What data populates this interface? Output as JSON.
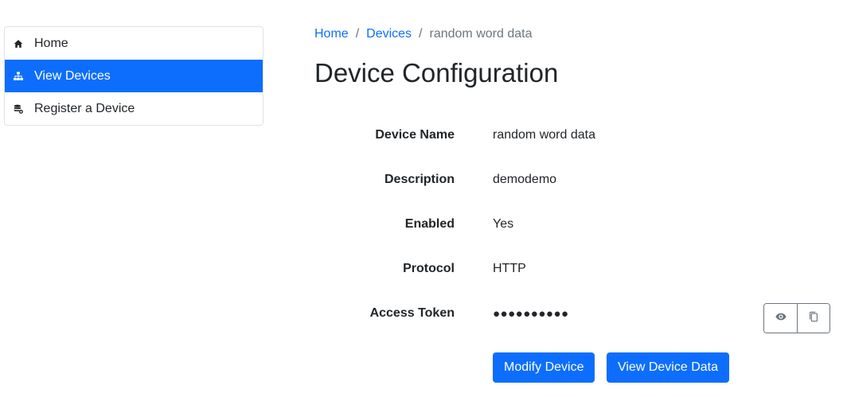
{
  "sidebar": {
    "items": [
      {
        "label": "Home",
        "icon": "home-icon",
        "active": false
      },
      {
        "label": "View Devices",
        "icon": "network-icon",
        "active": true
      },
      {
        "label": "Register a Device",
        "icon": "database-add-icon",
        "active": false
      }
    ]
  },
  "breadcrumb": {
    "home": "Home",
    "devices": "Devices",
    "current": "random word data",
    "separator": "/"
  },
  "page": {
    "title": "Device Configuration"
  },
  "details": {
    "device_name": {
      "label": "Device Name",
      "value": "random word data"
    },
    "description": {
      "label": "Description",
      "value": "demodemo"
    },
    "enabled": {
      "label": "Enabled",
      "value": "Yes"
    },
    "protocol": {
      "label": "Protocol",
      "value": "HTTP"
    },
    "access_token": {
      "label": "Access Token",
      "value": "●●●●●●●●●●"
    }
  },
  "token_actions": {
    "show_icon": "eye-icon",
    "copy_icon": "copy-icon"
  },
  "actions": {
    "modify": "Modify Device",
    "view_data": "View Device Data"
  },
  "colors": {
    "primary": "#0d6efd",
    "muted": "#6c757d",
    "border": "#dee2e6",
    "text": "#212529"
  }
}
